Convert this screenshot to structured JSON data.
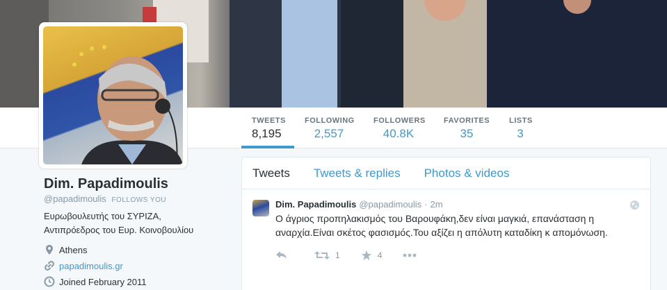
{
  "profile": {
    "name": "Dim. Papadimoulis",
    "handle": "@papadimoulis",
    "follows_you": "FOLLOWS YOU",
    "bio_line1": "Ευρωβουλευτής του ΣΥΡΙΖΑ,",
    "bio_line2": "Αντιπρόεδρος του Ευρ. Κοινοβουλίου",
    "location": "Athens",
    "website": "papadimoulis.gr",
    "joined": "Joined February 2011"
  },
  "stats": [
    {
      "label": "TWEETS",
      "value": "8,195"
    },
    {
      "label": "FOLLOWING",
      "value": "2,557"
    },
    {
      "label": "FOLLOWERS",
      "value": "40.8K"
    },
    {
      "label": "FAVORITES",
      "value": "35"
    },
    {
      "label": "LISTS",
      "value": "3"
    }
  ],
  "tabs": [
    "Tweets",
    "Tweets & replies",
    "Photos & videos"
  ],
  "tweet": {
    "name": "Dim. Papadimoulis",
    "handle": "@papadimoulis",
    "separator": "·",
    "time": "2m",
    "text": "Ο άγριος προπηλακισμός του Βαρουφάκη,δεν είναι μαγκιά, επανάσταση η αναρχία.Είναι σκέτος φασισμός.Του αξίζει η απόλυτη καταδίκη κ απομόνωση.",
    "retweets": "1",
    "favorites": "4"
  },
  "icons": {
    "location": "location-pin-icon",
    "link": "link-icon",
    "calendar": "clock-icon",
    "globe": "globe-icon",
    "reply": "reply-icon",
    "retweet": "retweet-icon",
    "favorite": "star-icon",
    "more": "more-icon"
  },
  "colors": {
    "accent": "#4099cc",
    "text": "#292f33",
    "muted": "#8899a6",
    "background": "#f5f8fa"
  }
}
